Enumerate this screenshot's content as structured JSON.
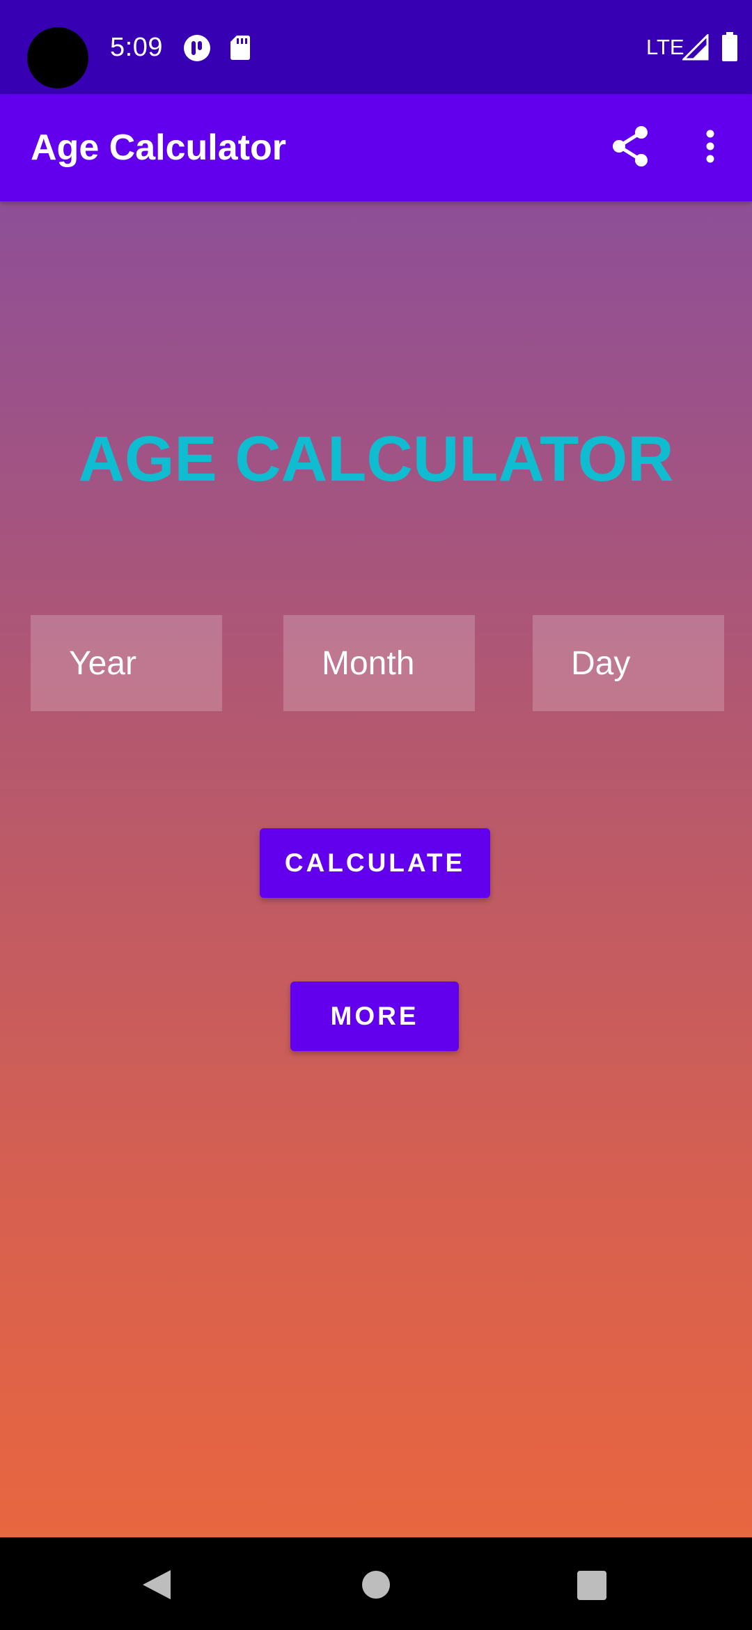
{
  "status_bar": {
    "time": "5:09",
    "network": "LTE",
    "icons": [
      "notification-app-icon",
      "sd-card-icon",
      "signal-icon",
      "battery-icon"
    ]
  },
  "app_bar": {
    "title": "Age Calculator",
    "actions": [
      "share-icon",
      "more-vert-icon"
    ]
  },
  "main": {
    "headline": "AGE CALCULATOR",
    "fields": {
      "year_placeholder": "Year",
      "month_placeholder": "Month",
      "day_placeholder": "Day"
    },
    "calculate_label": "CALCULATE",
    "more_label": "MORE"
  },
  "nav_bar": {
    "buttons": [
      "back-icon",
      "home-icon",
      "recents-icon"
    ]
  },
  "colors": {
    "status_bar": "#3700b3",
    "app_bar": "#6200ee",
    "button": "#6200ee",
    "headline": "#10bcd0",
    "gradient_top": "#8e4f97",
    "gradient_bottom": "#e86640"
  }
}
